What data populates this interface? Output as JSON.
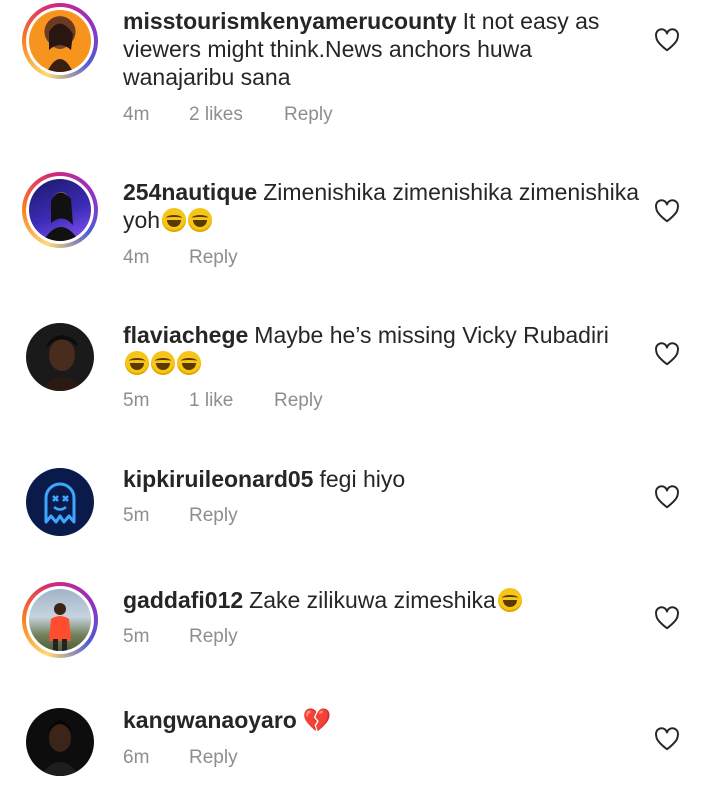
{
  "comments": [
    {
      "username": "misstourismkenyamerucounty",
      "text": "It not easy as viewers might think.News anchors huwa wanajaribu sana",
      "time": "4m",
      "likes": "2 likes",
      "reply": "Reply",
      "avatar_icon": "profile-photo",
      "emoji_count": 0
    },
    {
      "username": "254nautique",
      "text": "Zimenishika zimenishika zimenishika yoh",
      "time": "4m",
      "likes": "",
      "reply": "Reply",
      "avatar_icon": "profile-photo",
      "emoji_count": 2
    },
    {
      "username": "flaviachege",
      "text": "Maybe he’s missing Vicky Rubadiri",
      "time": "5m",
      "likes": "1 like",
      "reply": "Reply",
      "avatar_icon": "profile-photo",
      "emoji_count": 3
    },
    {
      "username": "kipkiruileonard05",
      "text": "fegi hiyo",
      "time": "5m",
      "likes": "",
      "reply": "Reply",
      "avatar_icon": "ghost-logo",
      "emoji_count": 0
    },
    {
      "username": "gaddafi012",
      "text": "Zake zilikuwa zimeshika",
      "time": "5m",
      "likes": "",
      "reply": "Reply",
      "avatar_icon": "profile-photo",
      "emoji_count": 1
    },
    {
      "username": "kangwanaoyaro",
      "text": "",
      "time": "6m",
      "likes": "",
      "reply": "Reply",
      "avatar_icon": "profile-photo",
      "emoji_count": 0,
      "heart_emoji": "💔"
    }
  ],
  "icons": {
    "like": "heart-outline-icon",
    "emoji": "grinning-squinting-face"
  },
  "colors": {
    "text": "#262626",
    "meta": "#8e8e8e",
    "story_ring": [
      "#feda75",
      "#fa7e1e",
      "#d62976",
      "#962fbf",
      "#4f5bd5"
    ]
  }
}
